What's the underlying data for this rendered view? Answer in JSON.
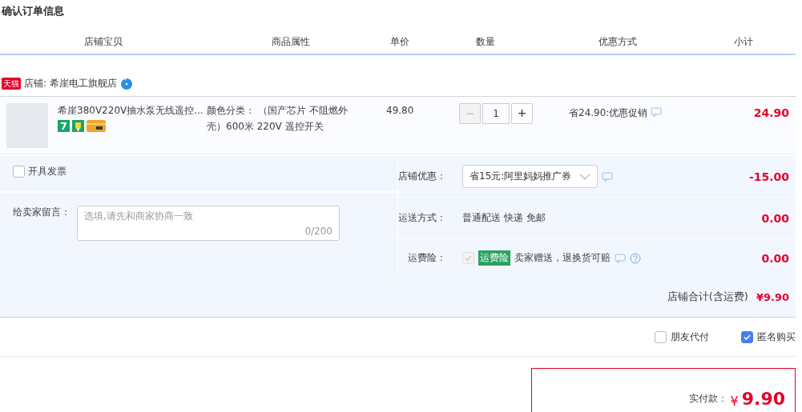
{
  "title": "确认订单信息",
  "columns": [
    "店铺宝贝",
    "商品属性",
    "单价",
    "数量",
    "优惠方式",
    "小计"
  ],
  "shop": {
    "badge": "天猫",
    "label": "店铺: 希崖电工旗舰店"
  },
  "items": [
    {
      "title": "希崖380V220V抽水泵无线遥控...",
      "service_mark": "7",
      "attributes": "颜色分类： （国产芯片 不阻燃外壳）600米 220V 遥控开关",
      "price": "49.80",
      "quantity": "1",
      "decrease": "−",
      "increase": "+",
      "promo": "省24.90:优惠促销",
      "subtotal": "24.90"
    }
  ],
  "invoice": {
    "label": "开具发票",
    "checked": false
  },
  "message": {
    "label": "给卖家留言：",
    "placeholder": "选填,请先和商家协商一致",
    "counter": "0/200"
  },
  "options": [
    {
      "kind": "select",
      "label": "店铺优惠：",
      "value": "省15元:阿里妈妈推广券",
      "amount": "-15.00"
    },
    {
      "kind": "text",
      "label": "运送方式：",
      "value": "普通配送 快递 免邮",
      "amount": "0.00"
    },
    {
      "kind": "insurance",
      "label": "运费险：",
      "checked": true,
      "disabled": true,
      "tag": "运费险",
      "value": "卖家赠送，退换货可赔",
      "amount": "0.00"
    }
  ],
  "shop_total": {
    "label": "店铺合计(含运费)",
    "amount": "¥9.90"
  },
  "checks": [
    {
      "label": "朋友代付",
      "checked": false
    },
    {
      "label": "匿名购买",
      "checked": true
    }
  ],
  "payment": {
    "label": "实付款：",
    "currency": "¥",
    "amount": "9.90"
  }
}
